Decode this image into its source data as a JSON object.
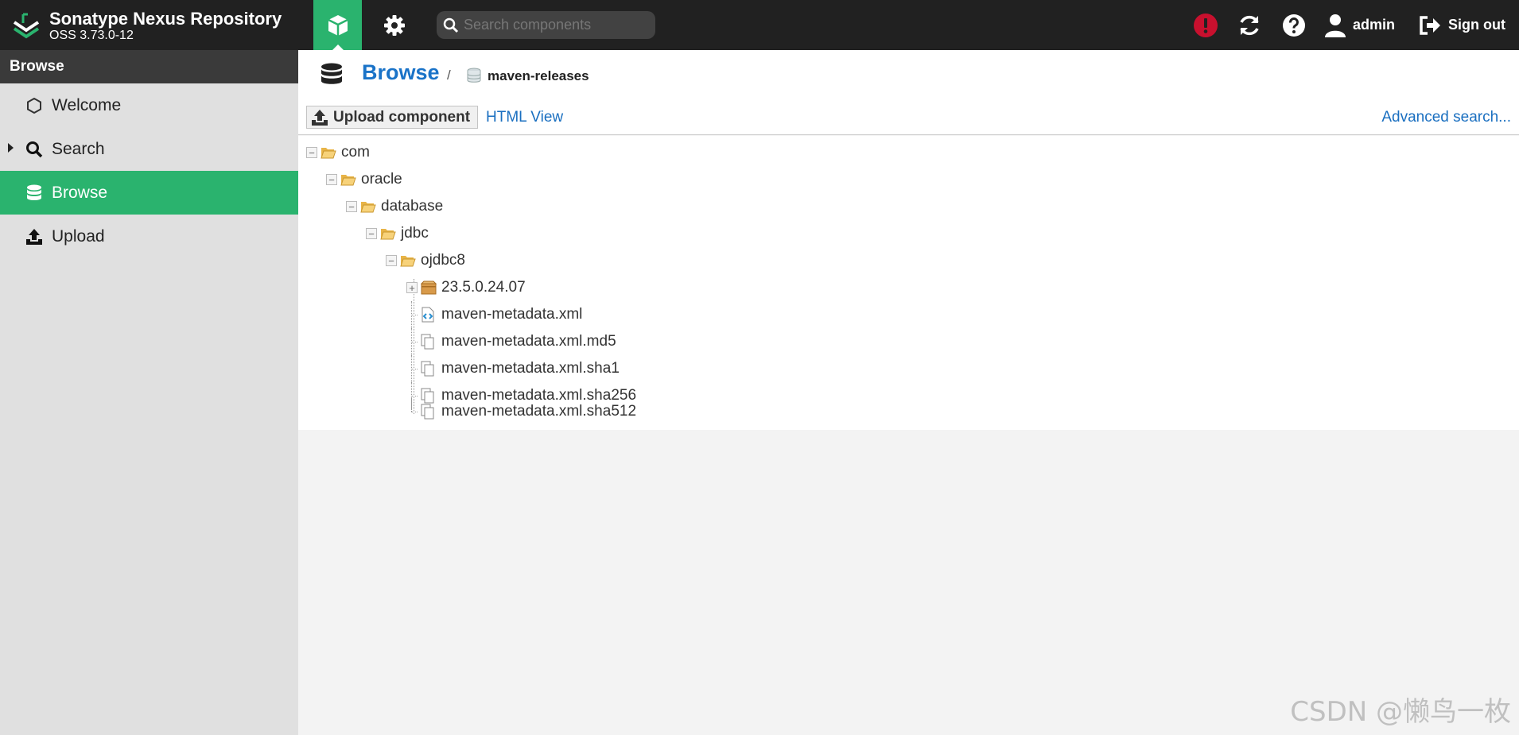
{
  "header": {
    "app_title": "Sonatype Nexus Repository",
    "version": "OSS 3.73.0-12",
    "search_placeholder": "Search components",
    "user": "admin",
    "signout_label": "Sign out"
  },
  "sidebar": {
    "header": "Browse",
    "items": [
      {
        "label": "Welcome",
        "icon": "hexagon-icon"
      },
      {
        "label": "Search",
        "icon": "search-icon"
      },
      {
        "label": "Browse",
        "icon": "database-icon"
      },
      {
        "label": "Upload",
        "icon": "upload-icon"
      }
    ]
  },
  "main": {
    "breadcrumb_title": "Browse",
    "breadcrumb_sep": "/",
    "repository": "maven-releases",
    "upload_button": "Upload component",
    "html_view": "HTML View",
    "advanced_search": "Advanced search...",
    "tree": [
      {
        "label": "com",
        "type": "folder",
        "depth": 0
      },
      {
        "label": "oracle",
        "type": "folder",
        "depth": 1
      },
      {
        "label": "database",
        "type": "folder",
        "depth": 2
      },
      {
        "label": "jdbc",
        "type": "folder",
        "depth": 3
      },
      {
        "label": "ojdbc8",
        "type": "folder",
        "depth": 4
      },
      {
        "label": "23.5.0.24.07",
        "type": "component",
        "depth": 5
      },
      {
        "label": "maven-metadata.xml",
        "type": "xml",
        "depth": 5
      },
      {
        "label": "maven-metadata.xml.md5",
        "type": "file",
        "depth": 5
      },
      {
        "label": "maven-metadata.xml.sha1",
        "type": "file",
        "depth": 5
      },
      {
        "label": "maven-metadata.xml.sha256",
        "type": "file",
        "depth": 5
      },
      {
        "label": "maven-metadata.xml.sha512",
        "type": "file",
        "depth": 5
      }
    ]
  },
  "watermark": "CSDN @懒鸟一枚",
  "colors": {
    "accent": "#2ab36e",
    "link": "#1a73c8",
    "header_bg": "#212121",
    "alert": "#c8102e"
  }
}
